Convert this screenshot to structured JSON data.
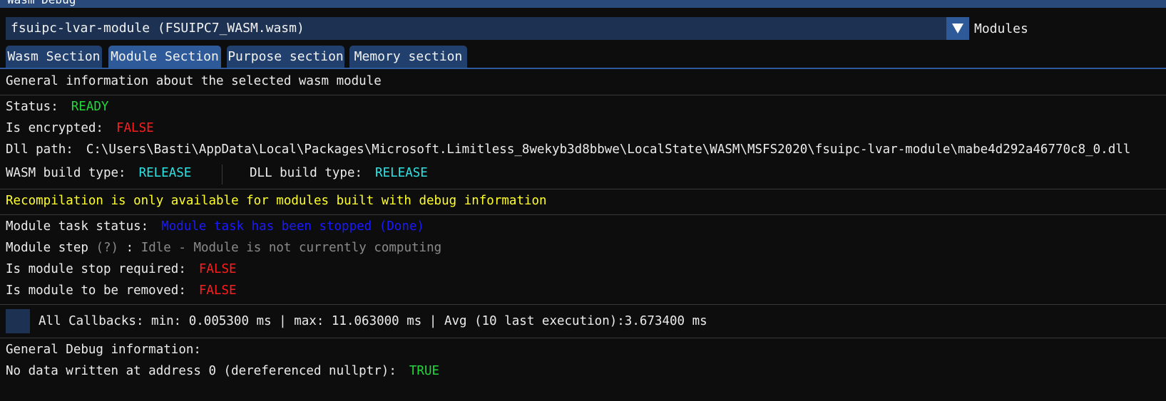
{
  "window": {
    "title": "Wasm Debug"
  },
  "module_selector": {
    "selected": "fsuipc-lvar-module (FSUIPC7_WASM.wasm)",
    "label": "Modules",
    "arrow_icon": "triangle-down-icon"
  },
  "tabs": [
    {
      "label": "Wasm Section",
      "active": false
    },
    {
      "label": "Module Section",
      "active": true
    },
    {
      "label": "Purpose section",
      "active": false
    },
    {
      "label": "Memory section",
      "active": false
    }
  ],
  "general": {
    "heading": "General information about the selected wasm module",
    "status_label": "Status:",
    "status_value": "READY",
    "encrypted_label": "Is encrypted:",
    "encrypted_value": "FALSE",
    "dll_path_label": "Dll path:",
    "dll_path_value": "C:\\Users\\Basti\\AppData\\Local\\Packages\\Microsoft.Limitless_8wekyb3d8bbwe\\LocalState\\WASM\\MSFS2020\\fsuipc-lvar-module\\mabe4d292a46770c8_0.dll",
    "wasm_build_label": "WASM build type:",
    "wasm_build_value": "RELEASE",
    "dll_build_label": "DLL build type:",
    "dll_build_value": "RELEASE"
  },
  "recompile_notice": "Recompilation is only available for modules built with debug information",
  "task": {
    "status_label": "Module task status:",
    "status_value": "Module task has been stopped (Done)",
    "step_label": "Module step",
    "step_help": "(?)",
    "step_sep": ":",
    "step_value": "Idle - Module is not currently computing",
    "stop_label": "Is module stop required:",
    "stop_value": "FALSE",
    "remove_label": "Is module to be removed:",
    "remove_value": "FALSE"
  },
  "callbacks": {
    "checked": false,
    "text": "All Callbacks: min: 0.005300 ms | max: 11.063000 ms | Avg (10 last execution):3.673400 ms"
  },
  "debug": {
    "heading": "General Debug information:",
    "null_label": "No data written at address 0 (dereferenced nullptr):",
    "null_value": "TRUE"
  },
  "colors": {
    "accent": "#2e5a99",
    "frame_bg": "#1d3252",
    "ok": "#22d83a",
    "error": "#ff1e1e",
    "info": "#2ee3e3",
    "warning": "#ffff2a",
    "task": "#1a1aff",
    "disabled": "#8a8a8a"
  }
}
